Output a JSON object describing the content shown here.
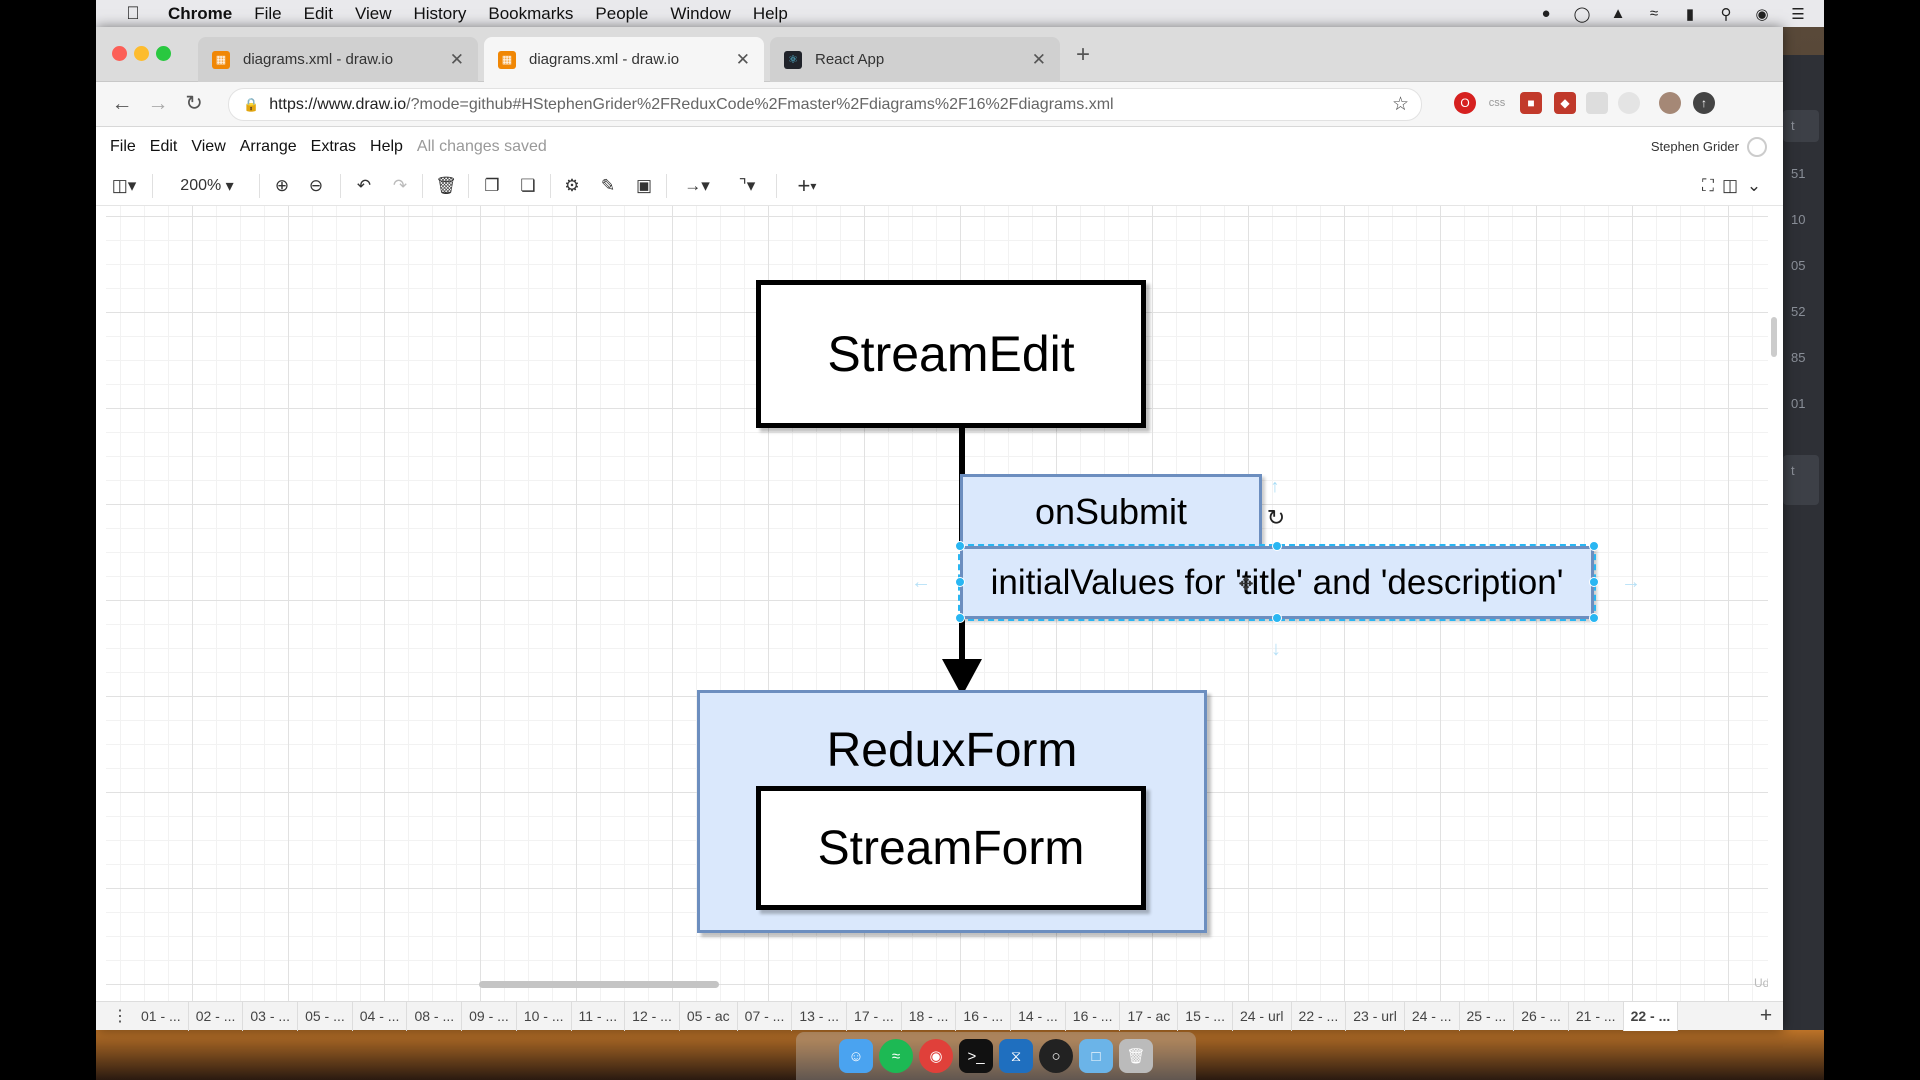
{
  "menubar": {
    "app": "Chrome",
    "items": [
      "File",
      "Edit",
      "View",
      "History",
      "Bookmarks",
      "People",
      "Window",
      "Help"
    ]
  },
  "tabs": [
    {
      "label": "diagrams.xml - draw.io",
      "active": false
    },
    {
      "label": "diagrams.xml - draw.io",
      "active": true
    },
    {
      "label": "React App",
      "active": false
    }
  ],
  "address": {
    "prefix": "https://www.draw.io",
    "rest": "/?mode=github#HStephenGrider%2FReduxCode%2Fmaster%2Fdiagrams%2F16%2Fdiagrams.xml"
  },
  "drawio": {
    "menus": [
      "File",
      "Edit",
      "View",
      "Arrange",
      "Extras",
      "Help"
    ],
    "status": "All changes saved",
    "user": "Stephen Grider",
    "zoom": "200%"
  },
  "diagram": {
    "stream_edit": "StreamEdit",
    "on_submit": "onSubmit",
    "initial_values": "initialValues for 'title' and 'description'",
    "redux_form": "ReduxForm",
    "stream_form": "StreamForm"
  },
  "page_tabs": [
    "01 - ...",
    "02 - ...",
    "03 - ...",
    "05 - ...",
    "04 - ...",
    "08 - ...",
    "09 - ...",
    "10 - ...",
    "11 - ...",
    "12 - ...",
    "05 - ac",
    "07 - ...",
    "13 - ...",
    "17 - ...",
    "18 - ...",
    "16 - ...",
    "14 - ...",
    "16 - ...",
    "17 - ac",
    "15 - ...",
    "24 - url",
    "22 - ...",
    "23 - url",
    "24 - ...",
    "25 - ...",
    "26 - ...",
    "21 - ...",
    "22 - ..."
  ],
  "selected_page_tab": "22 - ...",
  "dark_app_items": [
    "t",
    "51",
    "10",
    "05",
    "52",
    "85",
    "01",
    "t"
  ],
  "watermark": "Udemy",
  "colors": {
    "selection": "#29b6f2",
    "shape_fill_blue": "#dae8fc",
    "shape_border_blue": "#6c8ebf"
  }
}
